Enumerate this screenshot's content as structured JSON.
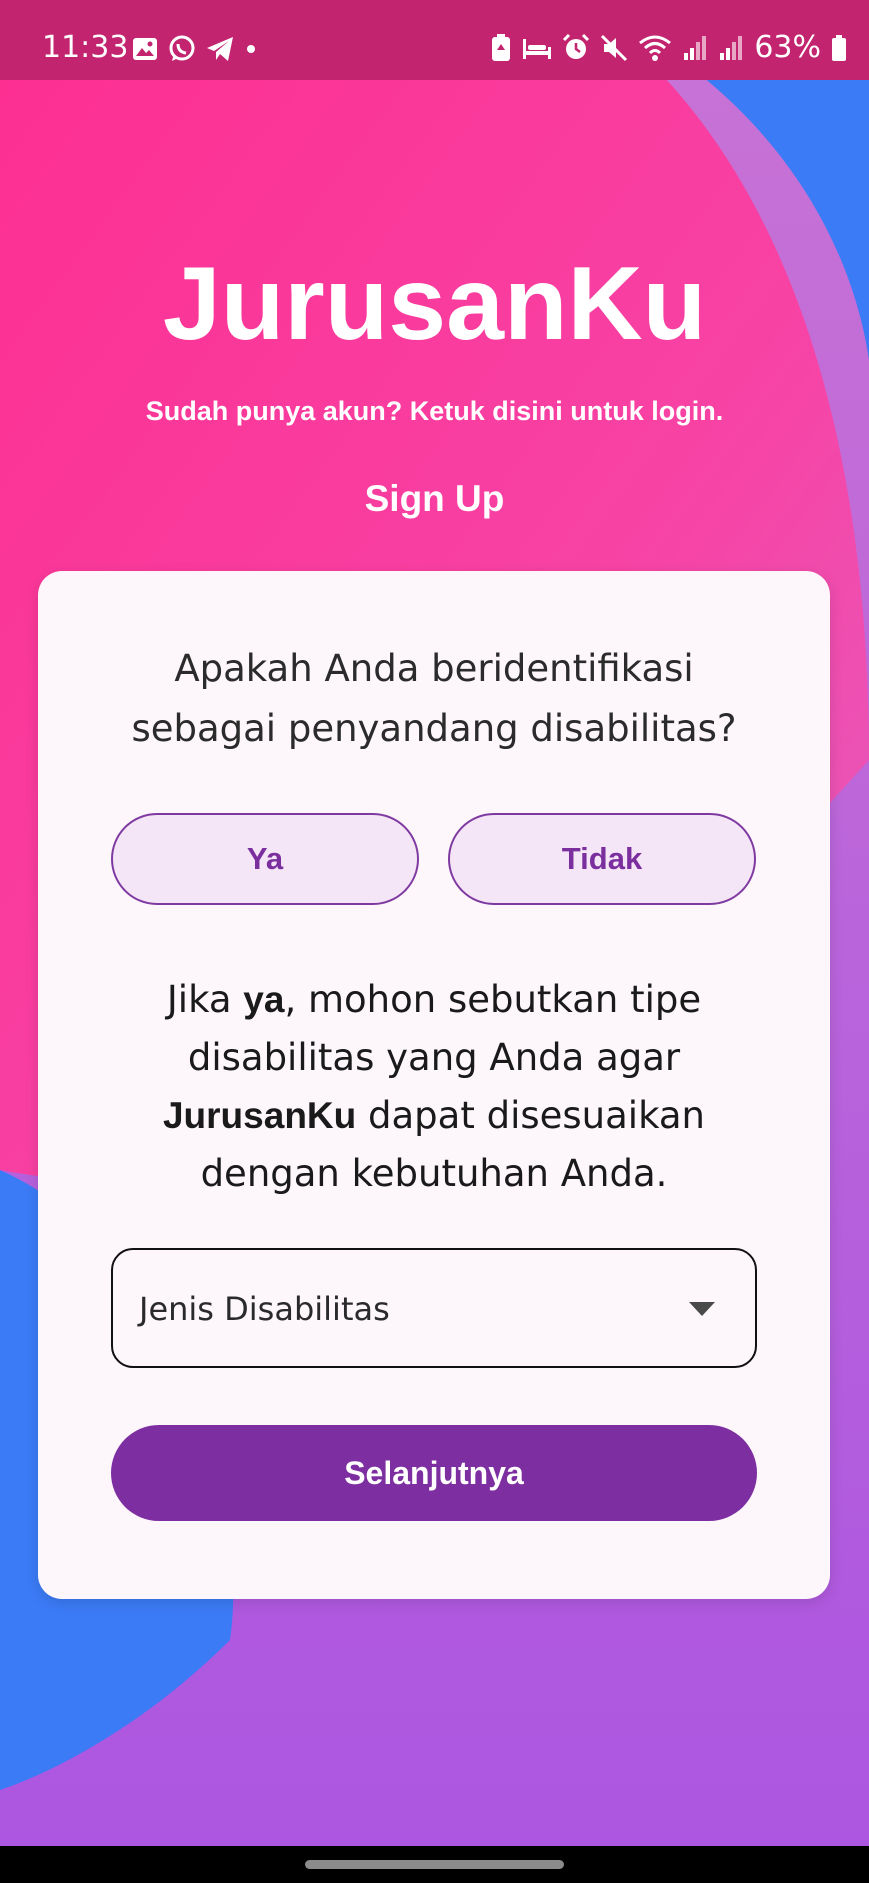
{
  "status_bar": {
    "time": "11:33",
    "battery": "63%",
    "left_icons": [
      "gallery-icon",
      "whatsapp-icon",
      "telegram-icon",
      "dot-icon"
    ],
    "right_icons": [
      "battery-saver-icon",
      "sleep-icon",
      "alarm-icon",
      "mute-icon",
      "wifi-icon",
      "signal-icon",
      "signal-icon",
      "battery-icon"
    ]
  },
  "header": {
    "app_title": "JurusanKu",
    "login_link": "Sudah punya akun? Ketuk disini untuk login.",
    "section_title": "Sign Up"
  },
  "card": {
    "question": "Apakah Anda beridentifikasi\nsebagai  penyandang disabilitas?",
    "options": {
      "yes": "Ya",
      "no": "Tidak"
    },
    "info": {
      "part1": "Jika ",
      "bold1": "ya",
      "part2": ", mohon sebutkan tipe disabilitas yang Anda agar ",
      "bold2": "JurusanKu",
      "part3": " dapat disesuaikan dengan kebutuhan Anda."
    },
    "dropdown_label": "Jenis Disabilitas",
    "next_label": "Selanjutnya"
  },
  "colors": {
    "pink": "#fc3497",
    "blue": "#3b7bf6",
    "purple": "#b45be0",
    "button_purple": "#7d2fa1",
    "status_bar": "#c2246f"
  }
}
